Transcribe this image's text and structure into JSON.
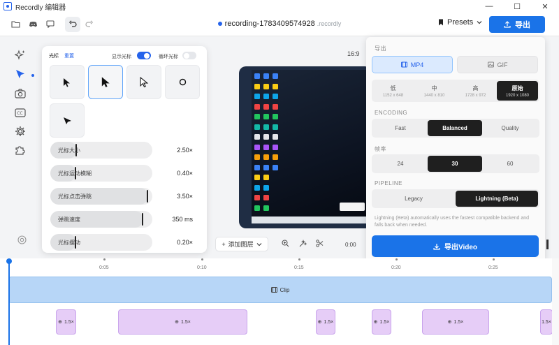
{
  "window": {
    "app_name": "Recordly 编辑器",
    "controls": [
      "—",
      "☐",
      "✕"
    ]
  },
  "toolbar": {
    "file_name": "recording-1783409574928",
    "file_ext": ".recordly",
    "presets_label": "Presets",
    "export_label": "导出"
  },
  "cursor_panel": {
    "tab_cursor": "光标",
    "tab_reset": "重置",
    "show_cursor_label": "显示光标",
    "show_cursor_on": true,
    "loop_cursor_label": "循环光标",
    "loop_cursor_on": false,
    "sliders": [
      {
        "label": "光标大小",
        "value": "2.50×",
        "fraction": 0.26
      },
      {
        "label": "光标运动模糊",
        "value": "0.40×",
        "fraction": 0.25
      },
      {
        "label": "光标点击弹跳",
        "value": "3.50×",
        "fraction": 0.96
      },
      {
        "label": "弹跳速度",
        "value": "350 ms",
        "fraction": 0.91
      },
      {
        "label": "光标摆动",
        "value": "0.20×",
        "fraction": 0.25
      }
    ]
  },
  "preview": {
    "aspect_ratio": "16:9",
    "add_layer_label": "添加图层",
    "time_readout": "0:00"
  },
  "export_panel": {
    "section_export": "导出",
    "formats": [
      {
        "label": "MP4",
        "active": true
      },
      {
        "label": "GIF",
        "active": false
      }
    ],
    "resolutions": [
      {
        "label": "低",
        "sub": "1152 x 648",
        "active": false
      },
      {
        "label": "中",
        "sub": "1440 x 810",
        "active": false
      },
      {
        "label": "高",
        "sub": "1728 x 972",
        "active": false
      },
      {
        "label": "原始",
        "sub": "1920 x 1080",
        "active": true
      }
    ],
    "section_encoding": "ENCODING",
    "encodings": [
      {
        "label": "Fast",
        "active": false
      },
      {
        "label": "Balanced",
        "active": true
      },
      {
        "label": "Quality",
        "active": false
      }
    ],
    "section_fps": "帧率",
    "fps": [
      {
        "label": "24",
        "active": false
      },
      {
        "label": "30",
        "active": true
      },
      {
        "label": "60",
        "active": false
      }
    ],
    "section_pipeline": "PIPELINE",
    "pipelines": [
      {
        "label": "Legacy",
        "active": false
      },
      {
        "label": "Lightning (Beta)",
        "active": true
      }
    ],
    "note": "Lightning (Beta) automatically uses the fastest compatible backend and falls back when needed.",
    "export_video_label": "导出Video"
  },
  "timeline": {
    "ruler_labels": [
      "0:05",
      "0:10",
      "0:15",
      "0:20",
      "0:25"
    ],
    "clip_label": "Clip",
    "zoom_segments": [
      "1.5×",
      "1.5×",
      "1.5×",
      "1.5×",
      "1.5×",
      "1.5×"
    ]
  },
  "colors": {
    "accent": "#1a73e8",
    "clip": "#b7d6f7",
    "zoom": "#e6cdf7",
    "selected_dark": "#1f1f1f"
  }
}
